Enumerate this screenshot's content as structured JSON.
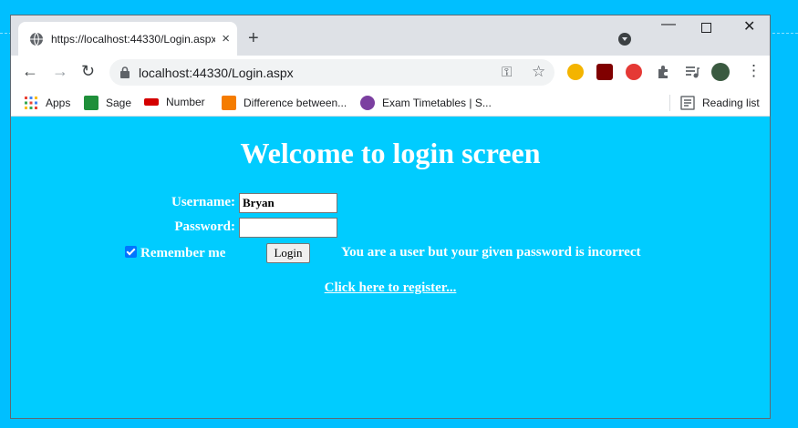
{
  "browser": {
    "tab": {
      "title": "https://localhost:44330/Login.aspx",
      "close": "×"
    },
    "new_tab": "+",
    "window_controls": {
      "minimize": "—",
      "close": "✕"
    },
    "address": "localhost:44330/Login.aspx",
    "nav": {
      "back": "←",
      "forward": "→",
      "reload": "↻"
    },
    "omnibox_icons": {
      "key": "⚿",
      "star": "☆"
    },
    "menu": "⋮"
  },
  "bookmarks": [
    {
      "label": "Apps",
      "color": "#4285f4"
    },
    {
      "label": "Sage",
      "color": "#1f8f3a"
    },
    {
      "label": "Number",
      "color": "#d40000"
    },
    {
      "label": "Difference between...",
      "color": "#f57c00"
    },
    {
      "label": "Exam Timetables | S...",
      "color": "#7b3fa0"
    }
  ],
  "reading_list": "Reading list",
  "page": {
    "heading": "Welcome to login screen",
    "username_label": "Username:",
    "username_value": "Bryan",
    "password_label": "Password:",
    "password_value": "",
    "remember_label": "Remember me",
    "remember_checked": true,
    "login_button": "Login",
    "message": "You are a user but your given password is incorrect",
    "register_link": "Click here to register..."
  },
  "colors": {
    "page_background": "#00ccff",
    "desktop_background": "#00bfff",
    "checkbox": "#0075ff"
  }
}
